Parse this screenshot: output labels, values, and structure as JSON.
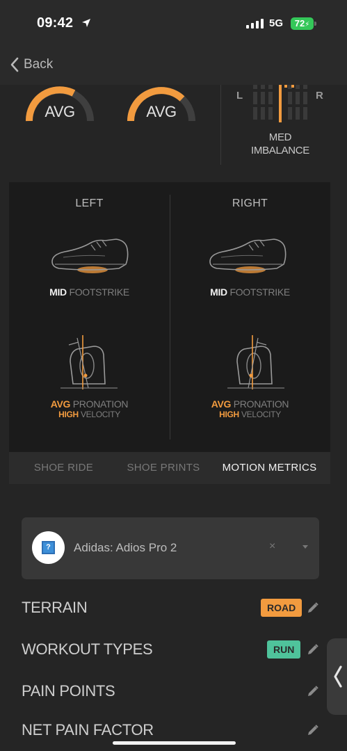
{
  "status": {
    "time": "09:42",
    "network": "5G",
    "battery": "72"
  },
  "nav": {
    "back_label": "Back"
  },
  "summary": {
    "gauge_left": "AVG",
    "gauge_right": "AVG",
    "imbalance_left": "L",
    "imbalance_right": "R",
    "imbalance_line1": "MED",
    "imbalance_line2": "IMBALANCE"
  },
  "motion": {
    "left": {
      "title": "LEFT",
      "footstrike_value": "MID",
      "footstrike_label": "FOOTSTRIKE",
      "pronation_value": "AVG",
      "pronation_label": "PRONATION",
      "velocity_value": "HIGH",
      "velocity_label": "VELOCITY"
    },
    "right": {
      "title": "RIGHT",
      "footstrike_value": "MID",
      "footstrike_label": "FOOTSTRIKE",
      "pronation_value": "AVG",
      "pronation_label": "PRONATION",
      "velocity_value": "HIGH",
      "velocity_label": "VELOCITY"
    }
  },
  "tabs": [
    {
      "label": "SHOE RIDE"
    },
    {
      "label": "SHOE PRINTS"
    },
    {
      "label": "MOTION METRICS"
    }
  ],
  "active_tab": "MOTION METRICS",
  "shoe": {
    "name": "Adidas: Adios Pro 2",
    "clear": "×",
    "avatar_glyph": "?"
  },
  "rows": {
    "terrain": {
      "label": "TERRAIN",
      "tag": "ROAD",
      "tag_color": "#f29b3f"
    },
    "workout_types": {
      "label": "WORKOUT TYPES",
      "tag": "RUN",
      "tag_color": "#4fc39b"
    },
    "pain_points": {
      "label": "PAIN POINTS"
    },
    "net_pain_factor": {
      "label": "NET PAIN FACTOR"
    }
  },
  "colors": {
    "accent": "#f29b3f",
    "panel": "#1b1b1b",
    "background": "#252525"
  },
  "icons": [
    "location-arrow-icon",
    "signal-icon",
    "back-chevron-icon",
    "shoe-footstrike-icon",
    "heel-pronation-icon",
    "question-icon",
    "clear-icon",
    "dropdown-caret-icon",
    "pencil-icon",
    "drawer-chevron-icon"
  ]
}
